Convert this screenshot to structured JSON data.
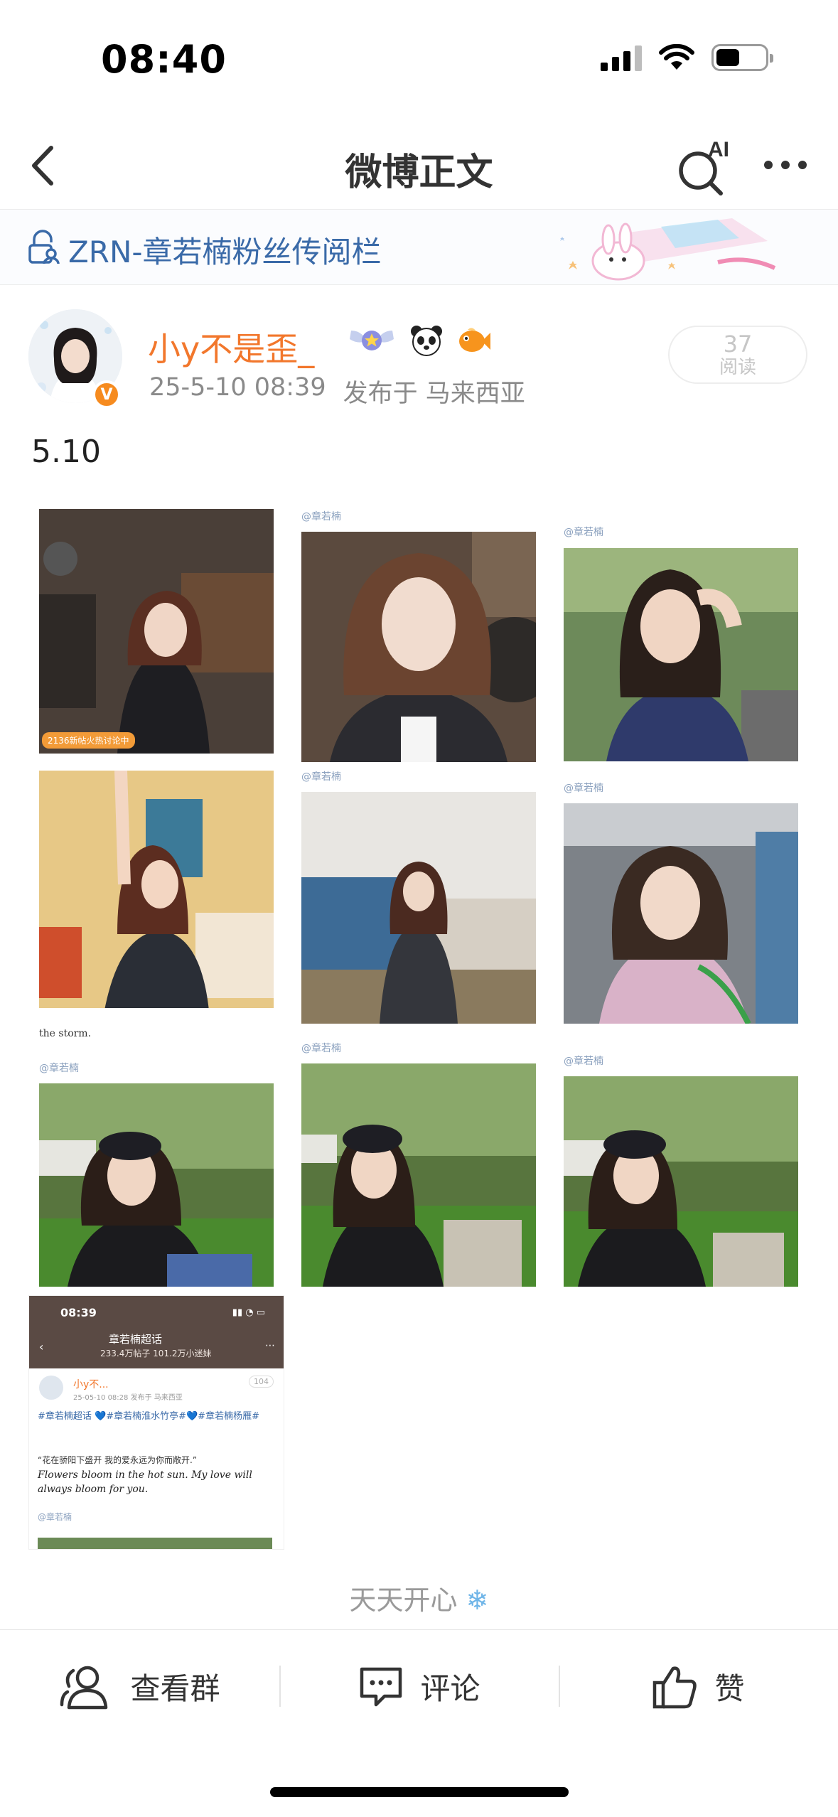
{
  "status_bar": {
    "time": "08:40"
  },
  "nav": {
    "title": "微博正文",
    "ai_label": "AI"
  },
  "banner": {
    "text": "ZRN-章若楠粉丝传阅栏"
  },
  "post": {
    "user_name": "小y不是歪_",
    "verified_badge": "V",
    "date": "25-5-10 08:39",
    "location": "发布于 马来西亚",
    "read_count": "37",
    "read_label": "阅读",
    "text": "5.10"
  },
  "photos": {
    "watermark": "@章若楠",
    "tag_hot": "2136新帖火热讨论中",
    "storm_text": "the storm."
  },
  "shot": {
    "time": "08:39",
    "title": "章若楠超话",
    "subtitle": "233.4万帖子 101.2万小迷妹",
    "user": "小y不...",
    "date": "25-05-10 08:28  发布于 马来西亚",
    "count": "104",
    "tags": "#章若楠超话 💙#章若楠淮水竹亭#💙#章若楠杨雁#",
    "quote_cn": "“花在骄阳下盛开 我的爱永远为你而敞开.”",
    "quote_en": "Flowers bloom in the hot sun. My love will always bloom for you.",
    "at": "@章若楠"
  },
  "footer": {
    "tag": "天天开心"
  },
  "toolbar": {
    "group_label": "查看群",
    "comment_label": "评论",
    "like_label": "赞"
  },
  "colors": {
    "username": "#f2772c",
    "banner_text": "#3a6aa8",
    "meta": "#8a8a8a"
  }
}
